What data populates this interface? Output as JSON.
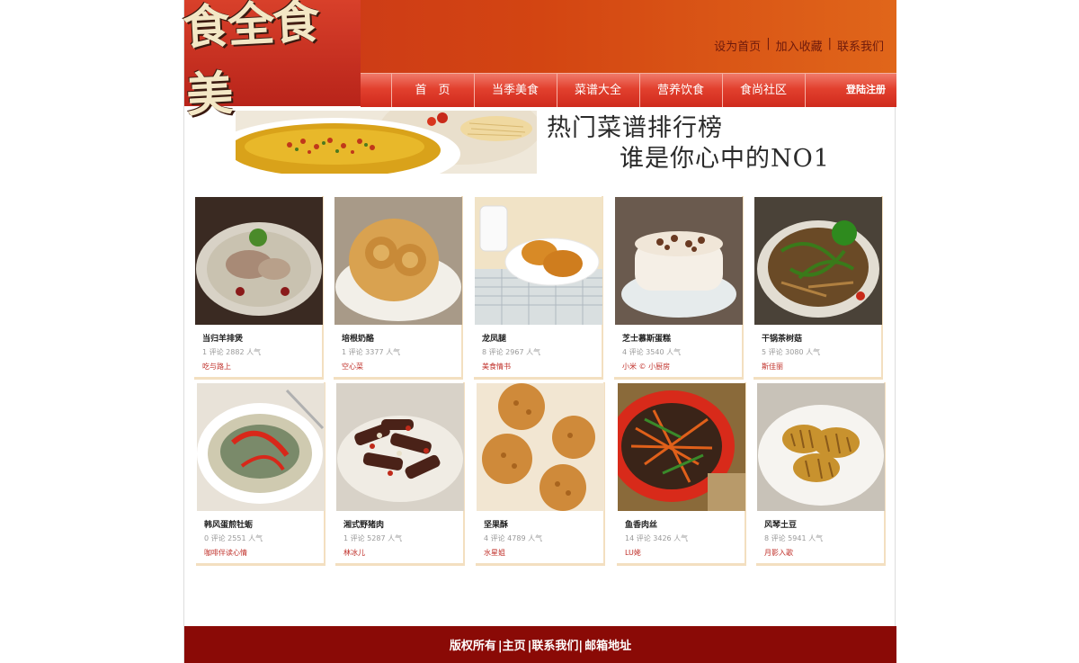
{
  "header": {
    "logo_text": "食全食美",
    "toplinks": [
      "设为首页",
      "加入收藏",
      "联系我们"
    ],
    "nav": [
      "首　页",
      "当季美食",
      "菜谱大全",
      "营养饮食",
      "食尚社区"
    ],
    "login_label": "登陆注册"
  },
  "banner": {
    "slogan_line1": "热门菜谱排行榜",
    "slogan_line2": "谁是你心中的NO1"
  },
  "recipes": [
    {
      "name": "当归羊排煲",
      "stats": "1 评论 2882 人气",
      "author": "吃与路上"
    },
    {
      "name": "培根奶酪",
      "stats": "1 评论 3377 人气",
      "author": "空心菜"
    },
    {
      "name": "龙凤腿",
      "stats": "8 评论 2967 人气",
      "author": "美食情书"
    },
    {
      "name": "芝士慕斯蛋糕",
      "stats": "4 评论 3540 人气",
      "author": "小米 © 小厨房"
    },
    {
      "name": "干锅茶树菇",
      "stats": "5 评论 3080 人气",
      "author": "斯佳丽"
    },
    {
      "name": "韩风蛋煎牡蛎",
      "stats": "0 评论 2551 人气",
      "author": "咖啡伴读心情"
    },
    {
      "name": "湘式野猪肉",
      "stats": "1 评论 5287 人气",
      "author": "林冰儿"
    },
    {
      "name": "坚果酥",
      "stats": "4 评论 4789 人气",
      "author": "水星姐"
    },
    {
      "name": "鱼香肉丝",
      "stats": "14 评论 3426 人气",
      "author": "LU姥"
    },
    {
      "name": "风琴土豆",
      "stats": "8 评论 5941 人气",
      "author": "月影入歌"
    }
  ],
  "footer": {
    "items": [
      "版权所有",
      "|主页",
      "|联系我们|",
      "邮箱地址"
    ]
  }
}
